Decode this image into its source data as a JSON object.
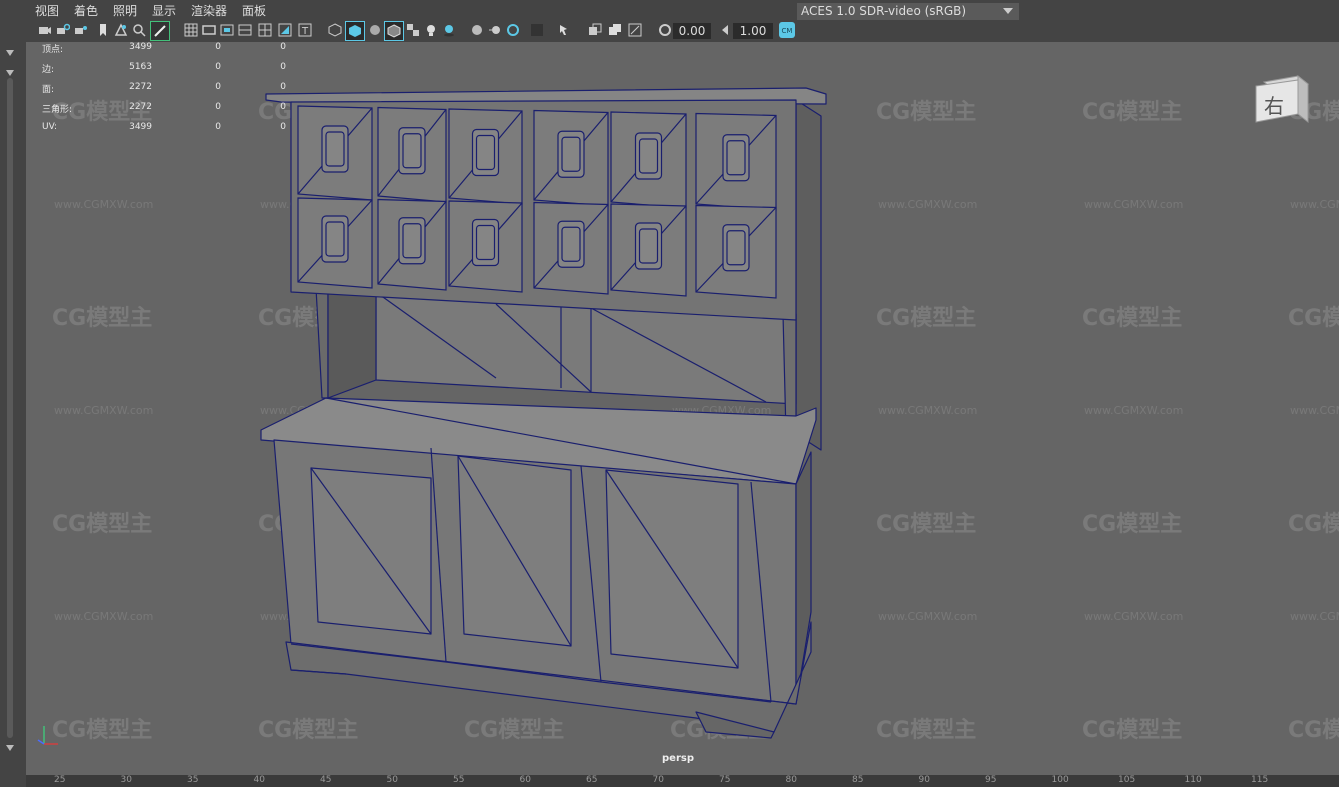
{
  "menu": [
    "视图",
    "着色",
    "照明",
    "显示",
    "渲染器",
    "面板"
  ],
  "toolbar": {
    "exposure_value": "0.00",
    "gamma_value": "1.00",
    "color_space": "ACES 1.0 SDR-video (sRGB)"
  },
  "hud": {
    "rows": [
      {
        "label": "顶点:",
        "count": "3499",
        "sel": "0",
        "extra": "0"
      },
      {
        "label": "边:",
        "count": "5163",
        "sel": "0",
        "extra": "0"
      },
      {
        "label": "面:",
        "count": "2272",
        "sel": "0",
        "extra": "0"
      },
      {
        "label": "三角形:",
        "count": "2272",
        "sel": "0",
        "extra": "0"
      },
      {
        "label": "UV:",
        "count": "3499",
        "sel": "0",
        "extra": "0"
      }
    ]
  },
  "viewcube_label": "右",
  "camera_name": "persp",
  "watermark": {
    "logo": "CG模型主",
    "url": "www.CGMXW.com"
  },
  "ruler": [
    "25",
    "30",
    "35",
    "40",
    "45",
    "50",
    "55",
    "60",
    "65",
    "70",
    "75",
    "80",
    "85",
    "90",
    "95",
    "100",
    "105",
    "110",
    "115"
  ],
  "colors": {
    "wire": "#1a1f6e",
    "mesh_fill": "#7b7b7b",
    "viewport_bg": "#656565",
    "ui_bg": "#444444",
    "accent": "#5cc8e6"
  }
}
